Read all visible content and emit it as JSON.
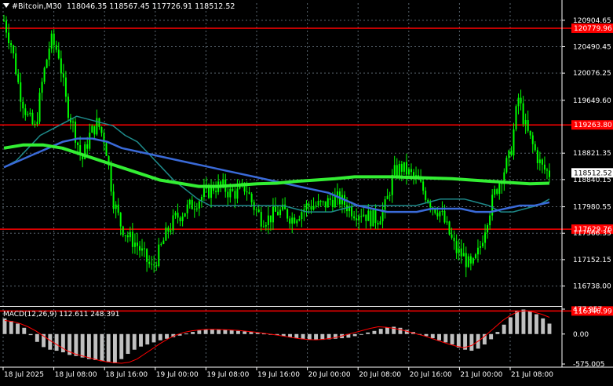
{
  "header": {
    "symbol": "#Bitcoin,M30",
    "ohlc": "118046.35 118567.45 117726.91 118512.52"
  },
  "indicator": {
    "label": "MACD(12,26,9) 112.611 248.391"
  },
  "colors": {
    "background": "#000000",
    "grid": "#5a6670",
    "candle": "#00ff00",
    "hline": "#ff0000",
    "ma_fast": "#1e8a8a",
    "ma_mid": "#3a6ad8",
    "ma_slow": "#33ee33",
    "macd_hist": "#c0c0c0",
    "macd_signal": "#ff0000",
    "axis_text": "#ffffff"
  },
  "chart_data": {
    "type": "candlestick",
    "price_axis": {
      "range": [
        116450,
        121050
      ],
      "ticks": [
        "120904.65",
        "120490.45",
        "120076.25",
        "119649.60",
        "118821.35",
        "118840.15",
        "117980.55",
        "117566.35",
        "117152.15",
        "116738.00"
      ],
      "tick_values": [
        120904.65,
        120490.45,
        120076.25,
        119649.6,
        118821.35,
        118407.15,
        117980.55,
        117566.35,
        117152.15,
        116738.0
      ]
    },
    "current_price": "118512.52",
    "horizontal_lines": [
      {
        "label": "120779.96",
        "value": 120779.96
      },
      {
        "label": "119263.80",
        "value": 119263.8
      },
      {
        "label": "117629.76",
        "value": 117629.76
      },
      {
        "label": "116346.99",
        "value": 116346.99
      }
    ],
    "time_axis": [
      "18 Jul 2025",
      "18 Jul 08:00",
      "18 Jul 16:00",
      "19 Jul 00:00",
      "19 Jul 08:00",
      "19 Jul 16:00",
      "20 Jul 00:00",
      "20 Jul 08:00",
      "20 Jul 16:00",
      "21 Jul 00:00",
      "21 Jul 08:00"
    ],
    "close_path": [
      120900,
      120500,
      119800,
      119400,
      119200,
      120000,
      120600,
      120400,
      119600,
      119200,
      118700,
      119100,
      119300,
      119000,
      118100,
      117700,
      117500,
      117400,
      117200,
      117000,
      117300,
      117600,
      117800,
      117900,
      118000,
      118100,
      118200,
      118300,
      118300,
      118200,
      118200,
      118300,
      118000,
      117800,
      117800,
      117900,
      117900,
      117800,
      117900,
      118000,
      118000,
      118000,
      118100,
      118100,
      118000,
      117900,
      117900,
      117800,
      117800,
      118000,
      118500,
      118600,
      118500,
      118400,
      118200,
      118000,
      117900,
      117600,
      117300,
      117200,
      117000,
      117300,
      117800,
      118200,
      118500,
      118800,
      119700,
      119200,
      118900,
      118600,
      118500
    ],
    "ma_fast": [
      118600,
      118700,
      118900,
      119100,
      119200,
      119300,
      119400,
      119350,
      119300,
      119250,
      119100,
      119000,
      118800,
      118600,
      118400,
      118250,
      118100,
      118000,
      118000,
      118000,
      118000,
      118000,
      118000,
      118000,
      117950,
      117900,
      117900,
      117900,
      117950,
      118000,
      118000,
      118000,
      118000,
      118000,
      118000,
      118050,
      118100,
      118100,
      118100,
      118050,
      118000,
      117900,
      117900,
      117950,
      118000,
      118100
    ],
    "ma_mid": [
      118600,
      118700,
      118800,
      118900,
      119000,
      119050,
      119050,
      119000,
      118900,
      118850,
      118800,
      118750,
      118700,
      118650,
      118600,
      118550,
      118500,
      118450,
      118400,
      118350,
      118300,
      118250,
      118200,
      118100,
      118000,
      117950,
      117900,
      117900,
      117900,
      117950,
      117950,
      117950,
      117900,
      117900,
      117950,
      118000,
      118000,
      118050
    ],
    "ma_slow": [
      118900,
      118950,
      118950,
      118900,
      118800,
      118700,
      118600,
      118500,
      118400,
      118350,
      118300,
      118300,
      118320,
      118340,
      118350,
      118380,
      118400,
      118420,
      118450,
      118450,
      118450,
      118440,
      118430,
      118420,
      118400,
      118380,
      118360,
      118340,
      118350
    ],
    "macd_axis": {
      "ticks": [
        "477.957",
        "0.00",
        "-575.005"
      ],
      "tick_values": [
        477.957,
        0,
        -575.005
      ]
    },
    "macd_hist": [
      300,
      250,
      200,
      120,
      -20,
      -150,
      -250,
      -300,
      -320,
      -350,
      -400,
      -420,
      -450,
      -480,
      -500,
      -520,
      -540,
      -560,
      -480,
      -380,
      -300,
      -240,
      -200,
      -160,
      -120,
      -90,
      -60,
      -30,
      10,
      40,
      70,
      90,
      95,
      90,
      80,
      70,
      60,
      50,
      40,
      25,
      10,
      -5,
      -20,
      -40,
      -60,
      -80,
      -100,
      -110,
      -115,
      -110,
      -100,
      -90,
      -80,
      -70,
      -40,
      -10,
      30,
      60,
      100,
      130,
      140,
      120,
      80,
      40,
      0,
      -40,
      -80,
      -120,
      -160,
      -200,
      -260,
      -300,
      -320,
      -280,
      -200,
      -100,
      40,
      180,
      320,
      440,
      470,
      440,
      380,
      300,
      200
    ],
    "macd_signal": [
      260,
      240,
      200,
      140,
      60,
      -40,
      -140,
      -230,
      -320,
      -380,
      -420,
      -460,
      -500,
      -530,
      -550,
      -560,
      -540,
      -480,
      -380,
      -280,
      -180,
      -90,
      -20,
      30,
      60,
      80,
      90,
      90,
      85,
      80,
      70,
      55,
      40,
      20,
      0,
      -20,
      -45,
      -70,
      -90,
      -105,
      -110,
      -100,
      -80,
      -50,
      -10,
      30,
      70,
      110,
      140,
      130,
      110,
      80,
      40,
      0,
      -40,
      -90,
      -140,
      -190,
      -230,
      -260,
      -220,
      -120,
      0,
      130,
      260,
      360,
      430,
      450,
      420,
      380,
      320
    ]
  }
}
